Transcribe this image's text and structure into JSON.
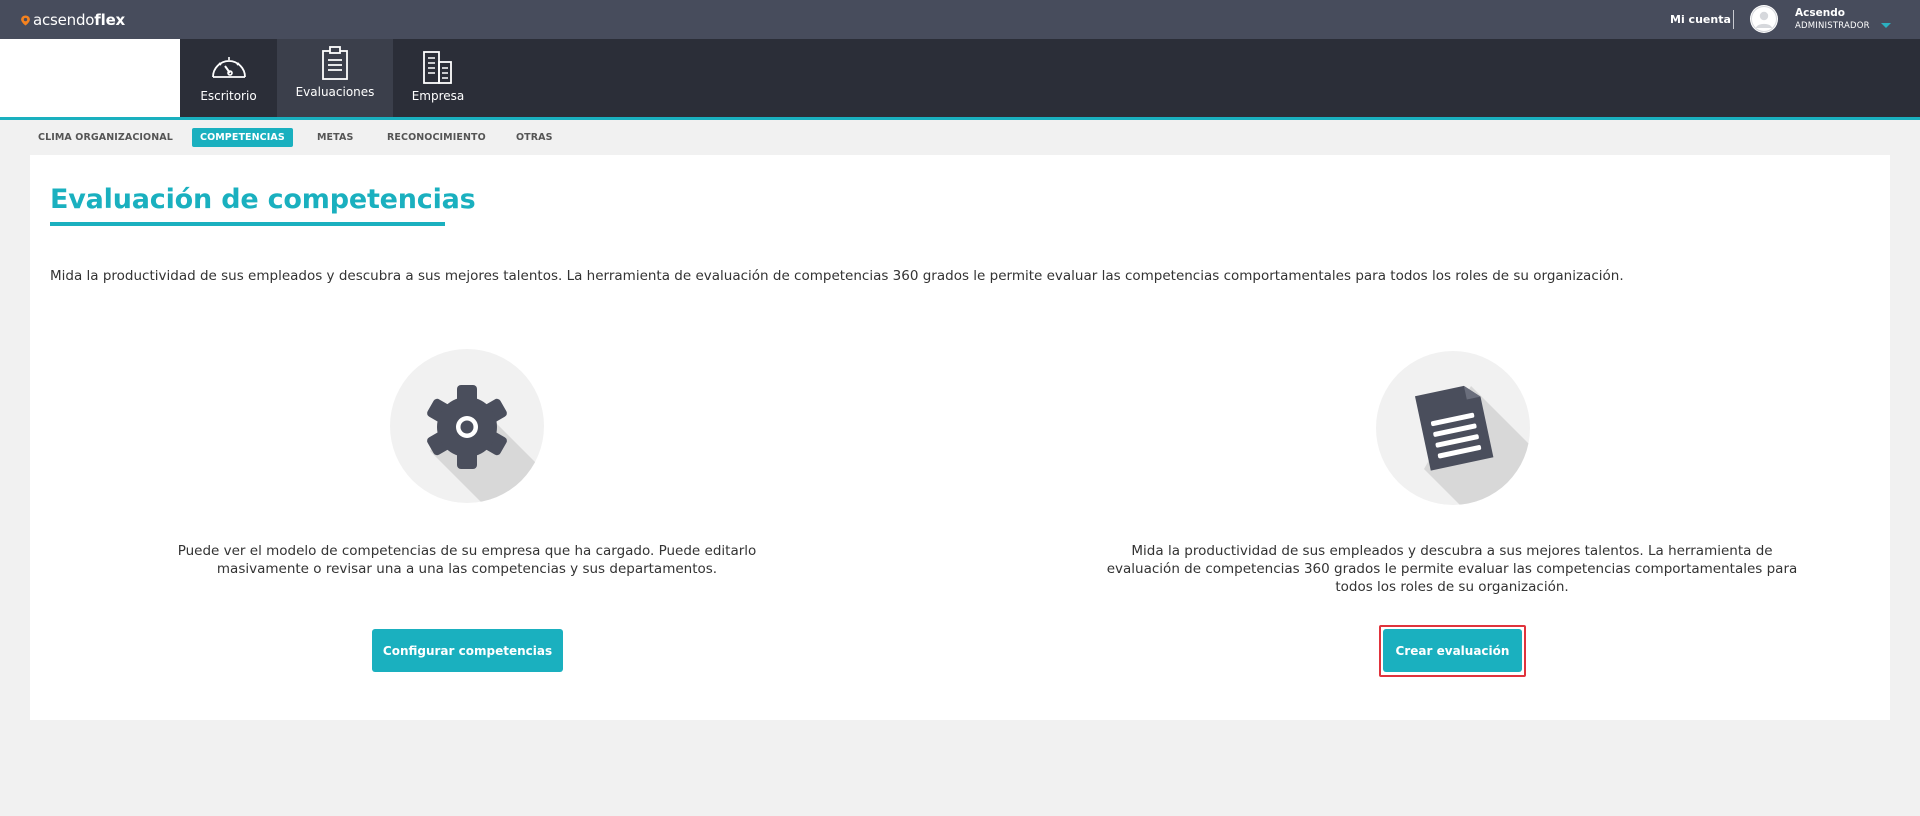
{
  "app": {
    "logo_prefix": "acsendo",
    "logo_suffix": "flex"
  },
  "topbar": {
    "account_link": "Mi cuenta",
    "user_name": "Acsendo",
    "user_role": "ADMINISTRADOR"
  },
  "nav": {
    "items": [
      {
        "label": "Escritorio",
        "icon": "speedometer-icon"
      },
      {
        "label": "Evaluaciones",
        "icon": "clipboard-icon",
        "active": true
      },
      {
        "label": "Empresa",
        "icon": "building-icon"
      }
    ]
  },
  "subnav": {
    "items": [
      {
        "label": "CLIMA ORGANIZACIONAL"
      },
      {
        "label": "COMPETENCIAS",
        "active": true
      },
      {
        "label": "METAS"
      },
      {
        "label": "RECONOCIMIENTO"
      },
      {
        "label": "OTRAS"
      }
    ]
  },
  "main": {
    "title": "Evaluación de competencias",
    "description": "Mida la productividad de sus empleados y descubra a sus mejores talentos. La herramienta de evaluación de competencias 360 grados le permite evaluar las competencias comportamentales para todos los roles de su organización.",
    "features": [
      {
        "icon": "gear-icon",
        "text": "Puede ver el modelo de competencias de su empresa que ha cargado. Puede editarlo masivamente o revisar una a una las competencias y sus departamentos.",
        "button_label": "Configurar competencias"
      },
      {
        "icon": "document-icon",
        "text": "Mida la productividad de sus empleados y descubra a sus mejores talentos. La herramienta de evaluación de competencias 360 grados le permite evaluar las competencias comportamentales para todos los roles de su organización.",
        "button_label": "Crear evaluación"
      }
    ]
  },
  "colors": {
    "accent": "#1ab0bf",
    "topbar": "#474c5c",
    "navbar": "#2b2e38",
    "highlight": "#e0333c"
  }
}
